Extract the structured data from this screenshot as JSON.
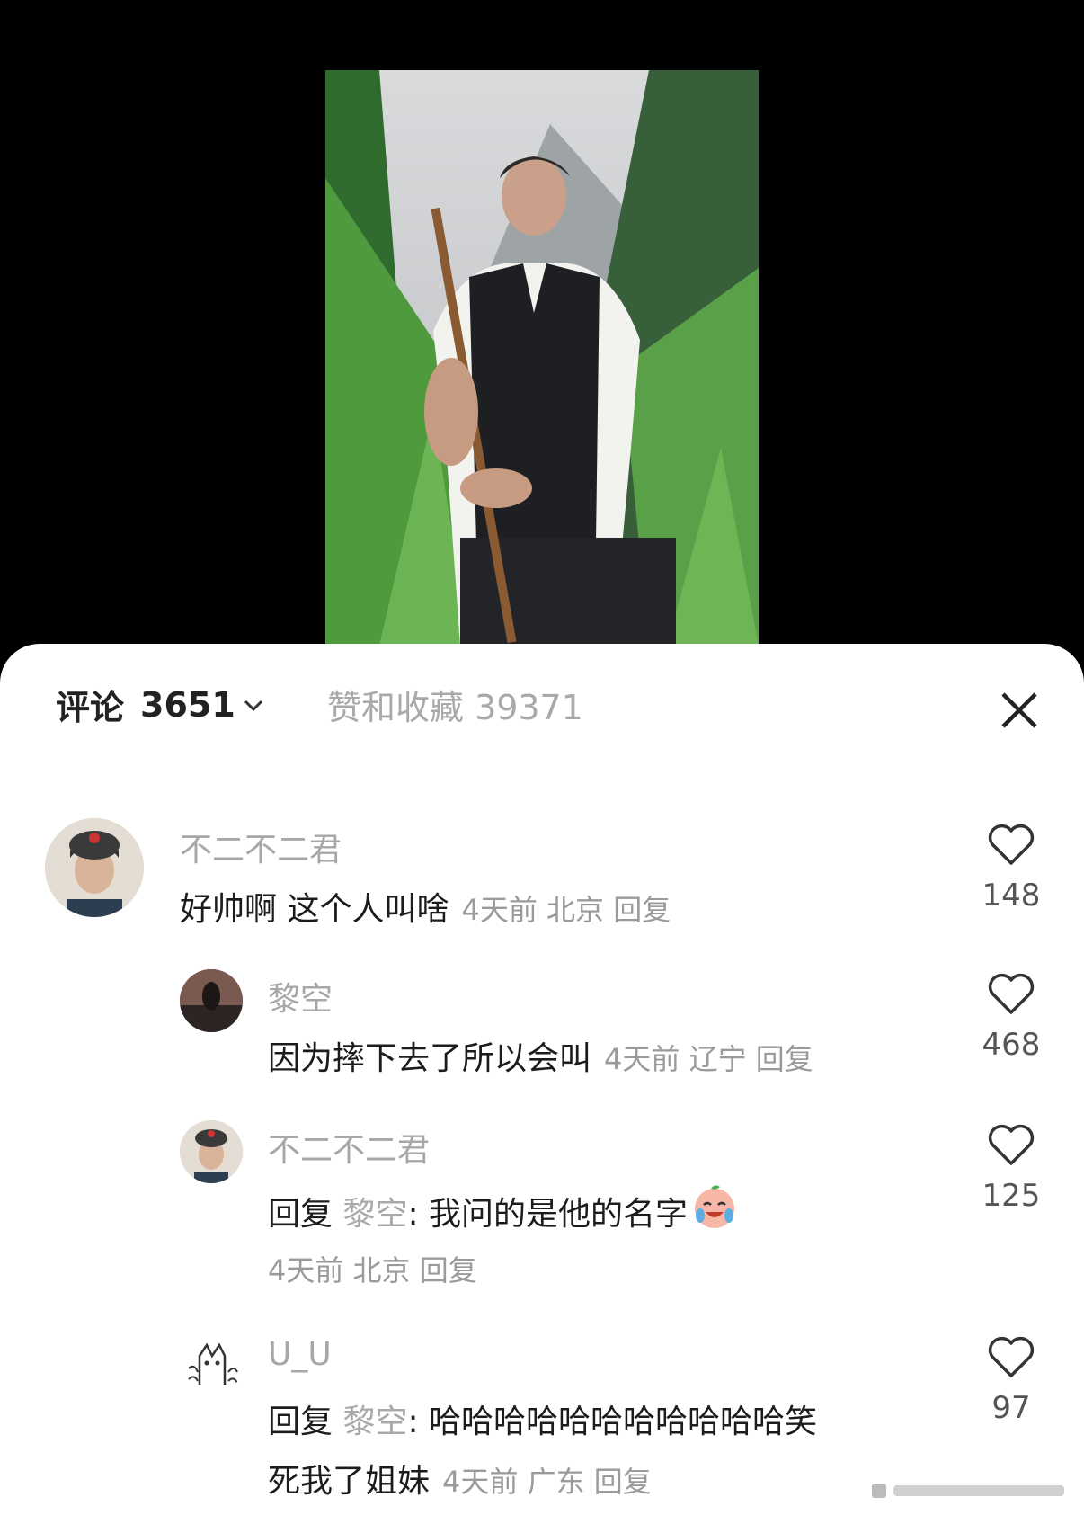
{
  "header": {
    "comments_label": "评论",
    "comments_count": "3651",
    "likes_label": "赞和收藏",
    "likes_count": "39371"
  },
  "comments": [
    {
      "username": "不二不二君",
      "text": "好帅啊 这个人叫啥",
      "time": "4天前",
      "location": "北京",
      "reply_label": "回复",
      "likes": "148"
    },
    {
      "username": "黎空",
      "text": "因为摔下去了所以会叫",
      "time": "4天前",
      "location": "辽宁",
      "reply_label": "回复",
      "likes": "468"
    },
    {
      "username": "不二不二君",
      "reply_prefix": "回复",
      "reply_to": "黎空",
      "text": ": 我问的是他的名字",
      "time": "4天前",
      "location": "北京",
      "reply_label": "回复",
      "likes": "125"
    },
    {
      "username": "U_U",
      "reply_prefix": "回复",
      "reply_to": "黎空",
      "text_line1": ": 哈哈哈哈哈哈哈哈哈哈哈笑",
      "text_line2": "死我了姐妹",
      "time": "4天前",
      "location": "广东",
      "reply_label": "回复",
      "likes": "97"
    }
  ],
  "icons": {
    "heart": "heart-icon",
    "close": "close-icon",
    "chevron": "chevron-down-icon",
    "emoji": "crying-laughing-emoji"
  },
  "colors": {
    "text": "#1c1c1c",
    "muted": "#a7a7a7",
    "background": "#ffffff"
  }
}
